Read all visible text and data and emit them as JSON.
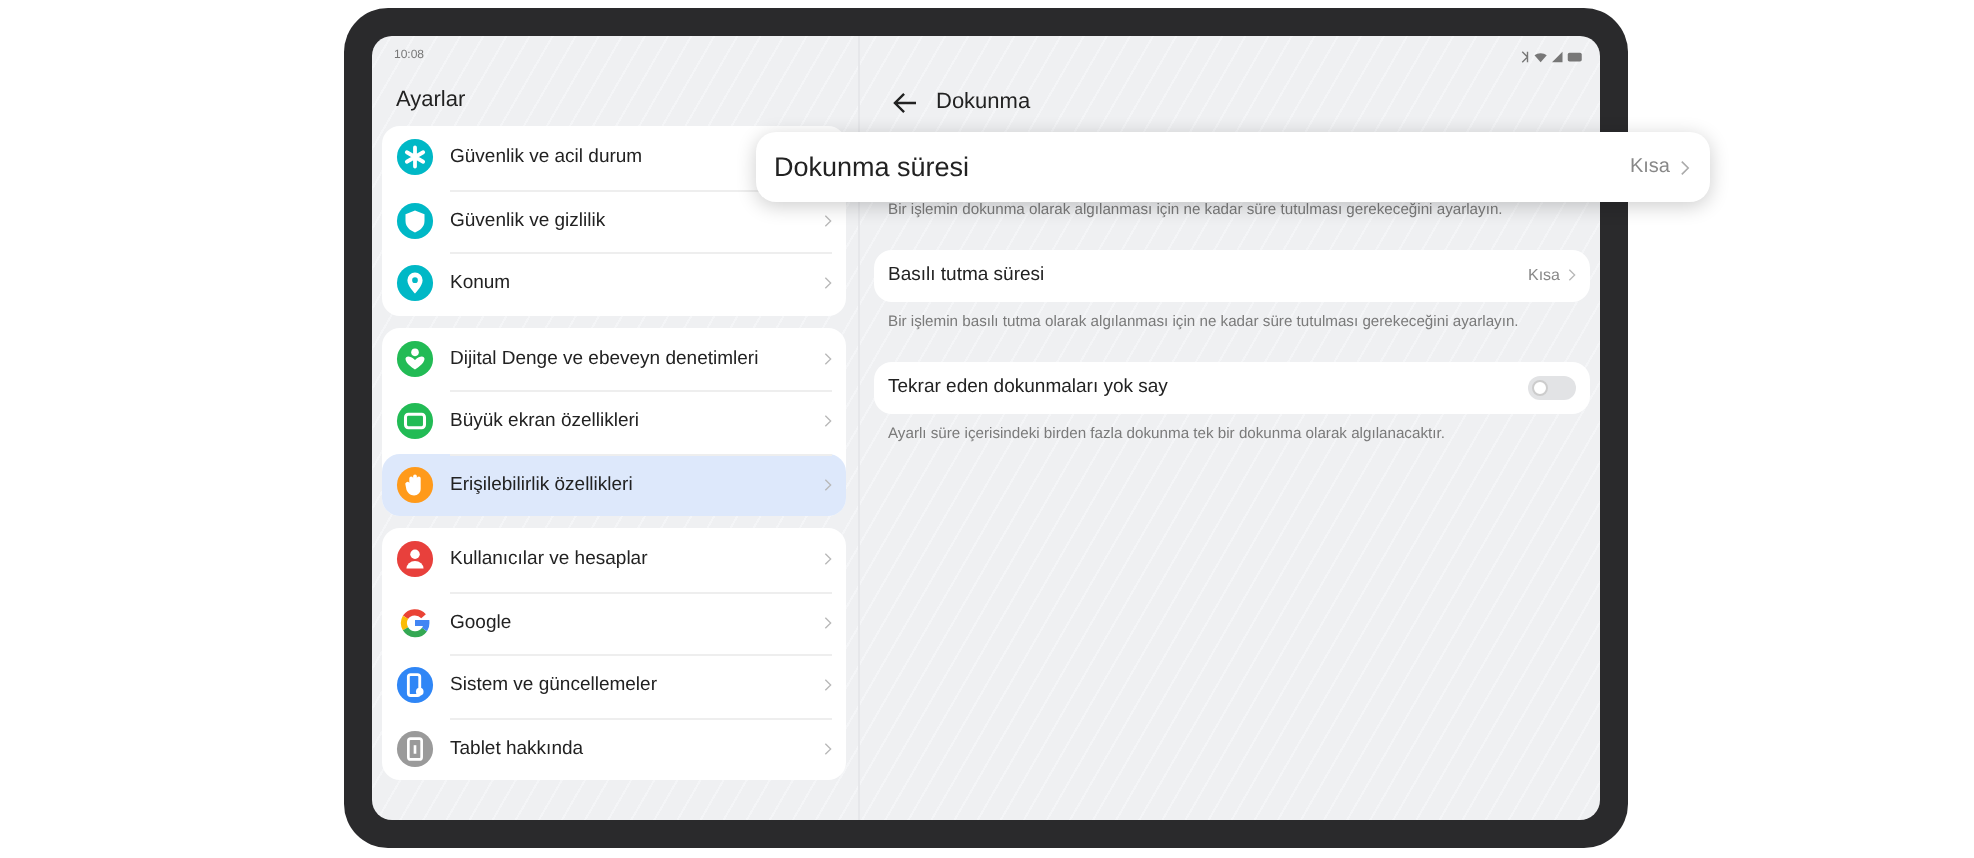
{
  "status_bar": {
    "time": "10:08"
  },
  "sidebar": {
    "title": "Ayarlar",
    "groups": [
      [
        {
          "label": "Güvenlik ve acil durum",
          "color": "#00b8c6",
          "selected": false
        },
        {
          "label": "Güvenlik ve gizlilik",
          "color": "#00b8c6",
          "selected": false
        },
        {
          "label": "Konum",
          "color": "#00b8c6",
          "selected": false
        }
      ],
      [
        {
          "label": "Dijital Denge ve ebeveyn denetimleri",
          "color": "#22bb55",
          "selected": false
        },
        {
          "label": "Büyük ekran özellikleri",
          "color": "#22bb55",
          "selected": false
        },
        {
          "label": "Erişilebilirlik özellikleri",
          "color": "#ff9a1a",
          "selected": true
        }
      ],
      [
        {
          "label": "Kullanıcılar ve hesaplar",
          "color": "#e8403c",
          "selected": false
        },
        {
          "label": "Google",
          "selected": false
        },
        {
          "label": "Sistem ve güncellemeler",
          "color": "#2f86f6",
          "selected": false
        },
        {
          "label": "Tablet hakkında",
          "color": "#9a9a9a",
          "selected": false
        }
      ]
    ]
  },
  "detail": {
    "title": "Dokunma",
    "settings": [
      {
        "kind": "hidden",
        "description": "Bir işlemin dokunma olarak algılanması için ne kadar süre tutulması gerekeceğini ayarlayın."
      },
      {
        "kind": "value",
        "label": "Basılı tutma süresi",
        "value": "Kısa",
        "description": "Bir işlemin basılı tutma olarak algılanması için ne kadar süre tutulması gerekeceğini ayarlayın."
      },
      {
        "kind": "toggle",
        "label": "Tekrar eden dokunmaları yok say",
        "on": false,
        "description": "Ayarlı süre içerisindeki birden fazla dokunma tek bir dokunma olarak algılanacaktır."
      }
    ]
  },
  "popup": {
    "label": "Dokunma süresi",
    "value": "Kısa"
  }
}
